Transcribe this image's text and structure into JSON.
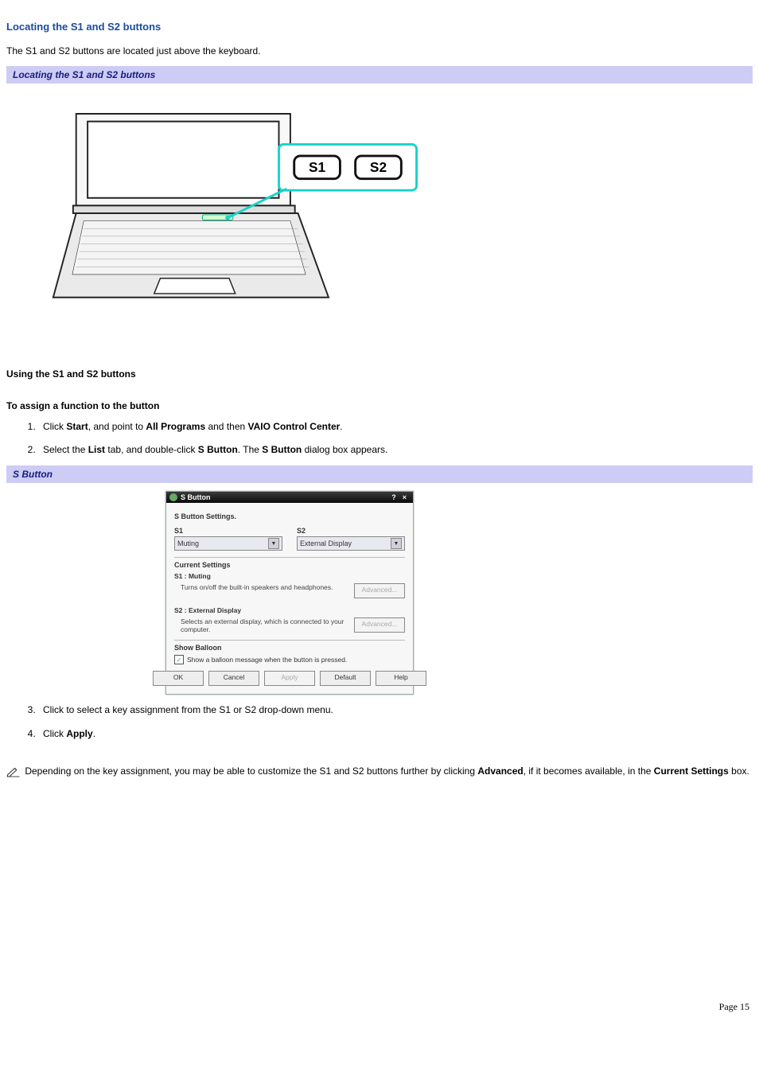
{
  "heading1": "Locating the S1 and S2 buttons",
  "intro": "The S1 and S2 buttons are located just above the keyboard.",
  "band1": "Locating the S1 and S2 buttons",
  "callout": {
    "s1": "S1",
    "s2": "S2"
  },
  "heading2": "Using the S1 and S2 buttons",
  "heading3": "To assign a function to the button",
  "steps12": {
    "s1a": "Click ",
    "s1b": "Start",
    "s1c": ", and point to ",
    "s1d": "All Programs",
    "s1e": " and then ",
    "s1f": "VAIO Control Center",
    "s1g": ".",
    "s2a": "Select the ",
    "s2b": "List",
    "s2c": " tab, and double-click ",
    "s2d": "S Button",
    "s2e": ". The ",
    "s2f": "S Button",
    "s2g": " dialog box appears."
  },
  "band2": "S Button",
  "dialog": {
    "title": "S Button",
    "settings": "S Button Settings.",
    "s1_label": "S1",
    "s2_label": "S2",
    "s1_value": "Muting",
    "s2_value": "External Display",
    "current": "Current Settings",
    "s1_cur_title": "S1 : Muting",
    "s1_cur_desc": "Turns on/off the built-in speakers and headphones.",
    "s2_cur_title": "S2 : External Display",
    "s2_cur_desc": "Selects an external display, which is connected to your computer.",
    "adv": "Advanced...",
    "balloon_title": "Show Balloon",
    "balloon_check": "Show a balloon message when the button is pressed.",
    "btn_ok": "OK",
    "btn_cancel": "Cancel",
    "btn_apply": "Apply",
    "btn_default": "Default",
    "btn_help": "Help"
  },
  "steps34": {
    "s3": "Click to select a key assignment from the S1 or S2 drop-down menu.",
    "s4a": "Click ",
    "s4b": "Apply",
    "s4c": "."
  },
  "note": {
    "a": " Depending on the key assignment, you may be able to customize the S1 and S2 buttons further by clicking ",
    "b": "Advanced",
    "c": ", if it becomes available, in the ",
    "d": "Current Settings",
    "e": " box."
  },
  "footer": "Page 15"
}
